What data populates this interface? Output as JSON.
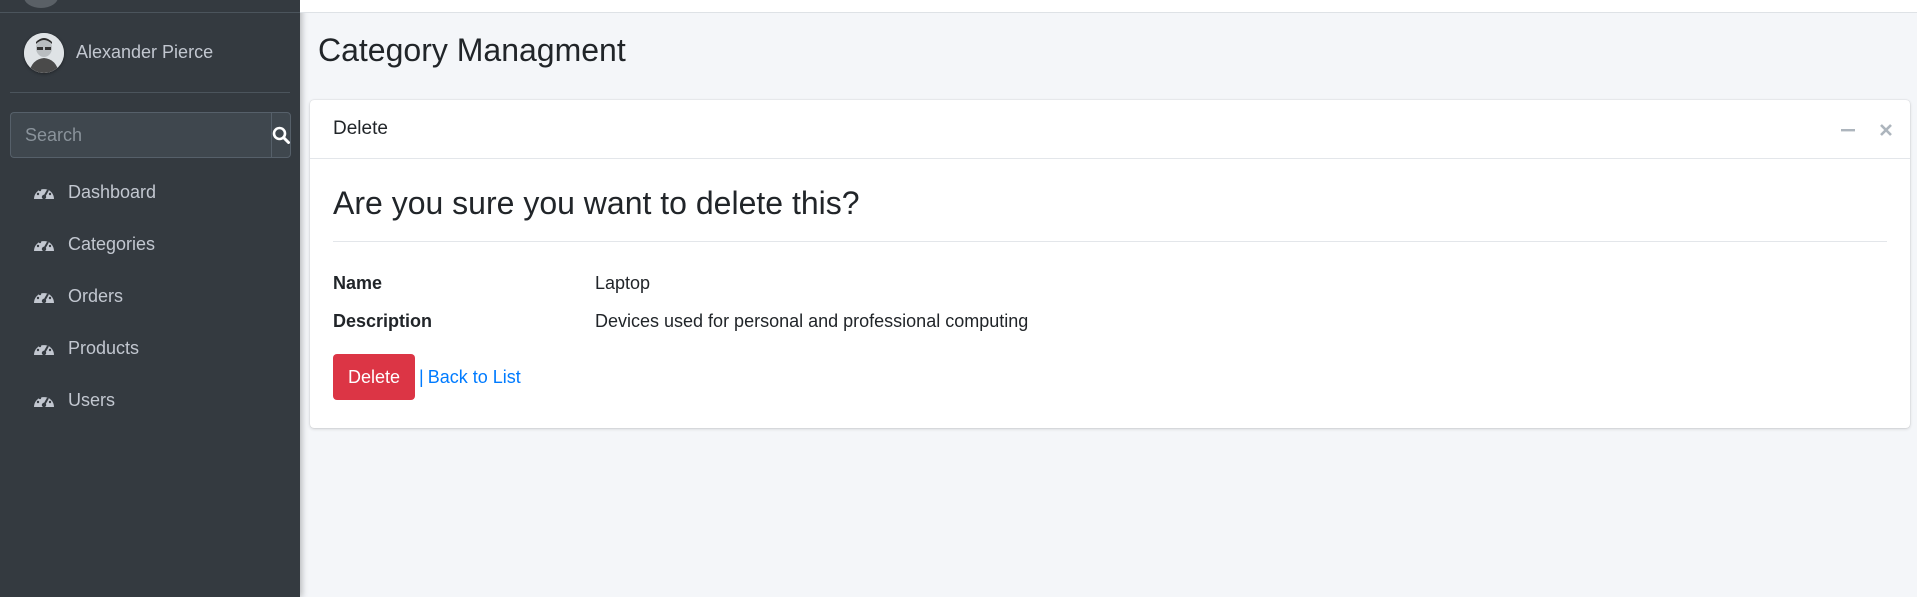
{
  "sidebar": {
    "user_name": "Alexander Pierce",
    "search": {
      "placeholder": "Search"
    },
    "items": [
      {
        "label": "Dashboard",
        "icon": "tachometer-icon"
      },
      {
        "label": "Categories",
        "icon": "tachometer-icon"
      },
      {
        "label": "Orders",
        "icon": "tachometer-icon"
      },
      {
        "label": "Products",
        "icon": "tachometer-icon"
      },
      {
        "label": "Users",
        "icon": "tachometer-icon"
      }
    ]
  },
  "page": {
    "title": "Category Managment"
  },
  "card": {
    "title": "Delete",
    "heading": "Are you sure you want to delete this?",
    "fields": [
      {
        "term": "Name",
        "value": "Laptop"
      },
      {
        "term": "Description",
        "value": "Devices used for personal and professional computing"
      }
    ],
    "delete_label": "Delete",
    "separator": "|",
    "back_label": "Back to List"
  },
  "colors": {
    "sidebar_bg": "#343a40",
    "content_bg": "#f4f6f9",
    "danger": "#dc3545",
    "link": "#007bff"
  }
}
